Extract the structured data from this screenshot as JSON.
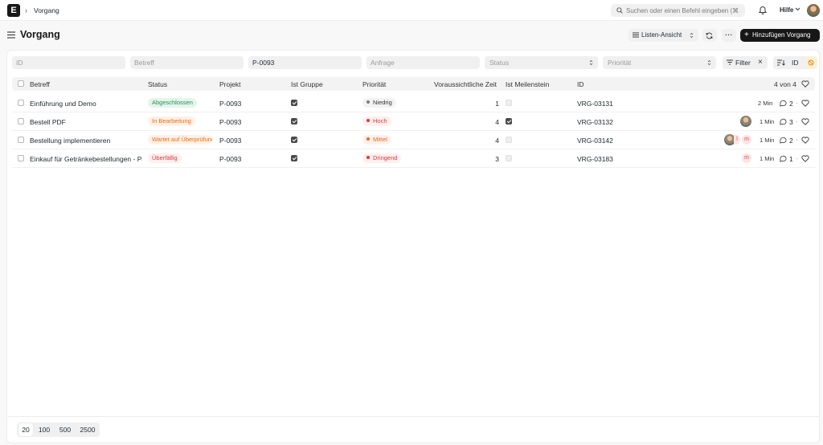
{
  "nav": {
    "logo": "E",
    "breadcrumb": "Vorgang",
    "search_placeholder": "Suchen oder einen Befehl eingeben (⌘",
    "help": "Hilfe"
  },
  "page": {
    "title": "Vorgang",
    "view_label": "Listen-Ansicht",
    "more_label": "···",
    "add_label": "Hinzufügen Vorgang"
  },
  "filters": {
    "id_placeholder": "ID",
    "subject_placeholder": "Betreff",
    "project_value": "P-0093",
    "request_placeholder": "Anfrage",
    "status_placeholder": "Status",
    "priority_placeholder": "Priorität",
    "filter_label": "Filter",
    "sort_label": "ID"
  },
  "table": {
    "headers": {
      "subject": "Betreff",
      "status": "Status",
      "project": "Projekt",
      "is_group": "Ist Gruppe",
      "priority": "Priorität",
      "expected_time": "Voraussichtliche Zeit",
      "is_milestone": "Ist Meilenstein",
      "id": "ID",
      "count": "4 von 4"
    },
    "rows": [
      {
        "subject": "Einführung und Demo",
        "status": "Abgeschlossen",
        "project": "P-0093",
        "is_group": true,
        "priority": "Niedrig",
        "expected_time": "1",
        "is_milestone": false,
        "id": "VRG-03131",
        "time": "2 Min",
        "comments": "2",
        "sep": "·"
      },
      {
        "subject": "Bestell PDF",
        "status": "In Bearbeitung",
        "project": "P-0093",
        "is_group": true,
        "priority": "Hoch",
        "expected_time": "4",
        "is_milestone": true,
        "id": "VRG-03132",
        "time": "1 Min",
        "comments": "3",
        "sep": "·"
      },
      {
        "subject": "Bestellung implementieren",
        "status": "Wartet auf Überprüfung",
        "project": "P-0093",
        "is_group": true,
        "priority": "Mittel",
        "expected_time": "4",
        "is_milestone": false,
        "id": "VRG-03142",
        "time": "1 Min",
        "comments": "2",
        "sep": "·",
        "avatar_initial": "m",
        "avatar_initial_cut": "l"
      },
      {
        "subject": "Einkauf für Getränkebestellungen - Pa",
        "status": "Überfällig",
        "project": "P-0093",
        "is_group": true,
        "priority": "Dringend",
        "expected_time": "3",
        "is_milestone": false,
        "id": "VRG-03183",
        "time": "1 Min",
        "comments": "1",
        "sep": "·",
        "avatar_initial": "m"
      }
    ]
  },
  "paging": [
    "20",
    "100",
    "500",
    "2500"
  ],
  "colors": {
    "status_done_bg": "#e4f5e9",
    "status_done_fg": "#278f5e",
    "status_progress_bg": "#fff1e7",
    "status_progress_fg": "#e86c13",
    "status_overdue_bg": "#fff0f0",
    "status_overdue_fg": "#e03636",
    "priority_low_dot": "#7c7c7c",
    "priority_high_dot": "#e03636"
  }
}
